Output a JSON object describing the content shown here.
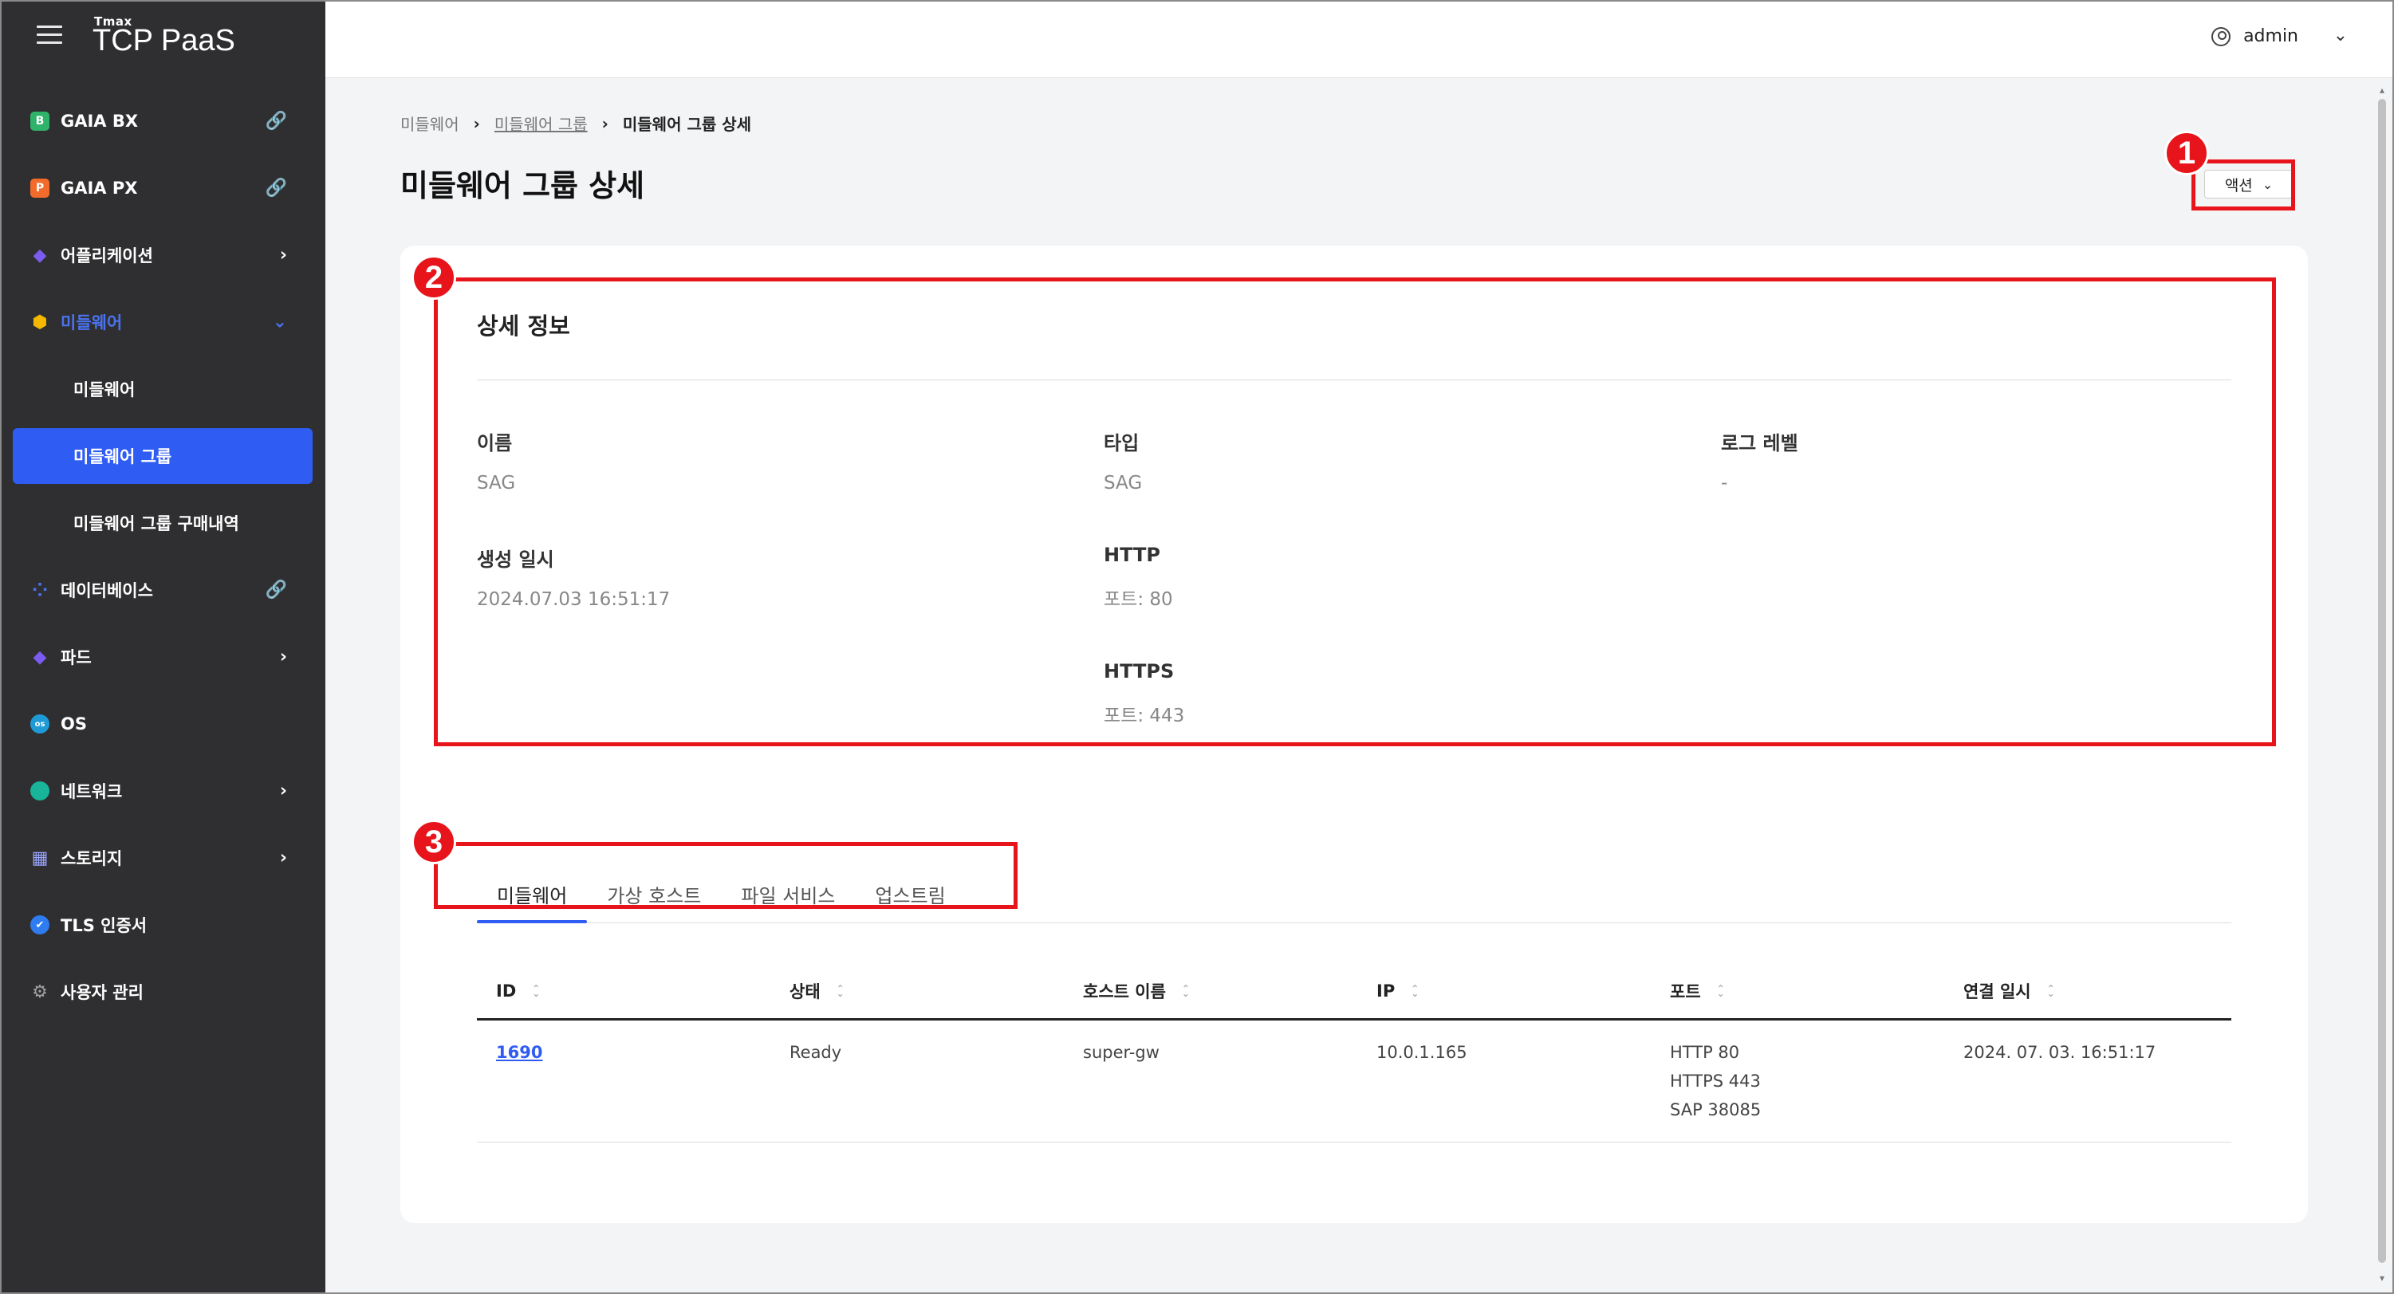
{
  "app": {
    "brand_small": "Tmax",
    "brand": "TCP PaaS"
  },
  "sidebar": {
    "items": [
      {
        "label": "GAIA BX",
        "icon": "gaia-bx-icon",
        "trail": "🔗",
        "color": "#2fb36a",
        "glyph": "B"
      },
      {
        "label": "GAIA PX",
        "icon": "gaia-px-icon",
        "trail": "🔗",
        "color": "#f26b2a",
        "glyph": "P"
      },
      {
        "label": "어플리케이션",
        "icon": "cube-icon",
        "trail": "›",
        "color": "#7b5cf0",
        "glyph": "◆"
      },
      {
        "label": "미들웨어",
        "icon": "middleware-icon",
        "trail": "⌄",
        "color": "#f5b800",
        "glyph": "⬢"
      },
      {
        "label": "데이터베이스",
        "icon": "grid-icon",
        "trail": "🔗",
        "color": "#4a73f0",
        "glyph": "⁘"
      },
      {
        "label": "파드",
        "icon": "pod-icon",
        "trail": "›",
        "color": "#7b5cf0",
        "glyph": "◆"
      },
      {
        "label": "OS",
        "icon": "os-icon",
        "trail": "",
        "color": "#1e9bd7",
        "glyph": "●"
      },
      {
        "label": "네트워크",
        "icon": "globe-icon",
        "trail": "›",
        "color": "#18b59a",
        "glyph": "●"
      },
      {
        "label": "스토리지",
        "icon": "storage-icon",
        "trail": "›",
        "color": "#7d8bff",
        "glyph": "▦"
      },
      {
        "label": "TLS 인증서",
        "icon": "certificate-icon",
        "trail": "",
        "color": "#2f7bf0",
        "glyph": "✔"
      },
      {
        "label": "사용자 관리",
        "icon": "gear-icon",
        "trail": "",
        "color": "#888888",
        "glyph": "⚙"
      }
    ],
    "sub_items": [
      "미들웨어",
      "미들웨어 그룹",
      "미들웨어 그룹 구매내역"
    ]
  },
  "topbar": {
    "user": "admin"
  },
  "breadcrumb": [
    "미들웨어",
    "미들웨어 그룹",
    "미들웨어 그룹 상세"
  ],
  "page": {
    "title": "미들웨어 그룹 상세",
    "action_label": "액션"
  },
  "detail": {
    "title": "상세 정보",
    "name_label": "이름",
    "name_value": "SAG",
    "type_label": "타입",
    "type_value": "SAG",
    "loglevel_label": "로그 레벨",
    "loglevel_value": "-",
    "created_label": "생성 일시",
    "created_value": "2024.07.03 16:51:17",
    "http_label": "HTTP",
    "http_value": "포트: 80",
    "https_label": "HTTPS",
    "https_value": "포트: 443"
  },
  "tabs": [
    "미들웨어",
    "가상 호스트",
    "파일 서비스",
    "업스트림"
  ],
  "table": {
    "headers": [
      "ID",
      "상태",
      "호스트 이름",
      "IP",
      "포트",
      "연결 일시"
    ],
    "rows": [
      {
        "id": "1690",
        "status": "Ready",
        "host": "super-gw",
        "ip": "10.0.1.165",
        "ports": [
          "HTTP 80",
          "HTTPS 443",
          "SAP 38085"
        ],
        "connected": "2024. 07. 03. 16:51:17"
      }
    ]
  },
  "annotations": [
    "1",
    "2",
    "3"
  ],
  "colors": {
    "sidebar_bg": "#2f2f31",
    "accent": "#2f5cf2",
    "annotation": "#e8141b",
    "main_bg": "#f3f4f6"
  }
}
